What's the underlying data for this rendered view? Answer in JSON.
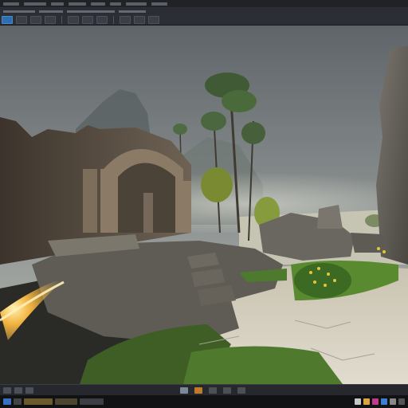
{
  "colors": {
    "sky_top": "#5e6468",
    "sky_bottom": "#a9adaa",
    "sand": "#cfc9bb",
    "grass": "#4f7a2e",
    "stone": "#6a6761",
    "accent_toolbar": "#2f6fb0",
    "fire": "#f2b542"
  },
  "icons": {
    "menubar": "menu-items",
    "toolbar": [
      "select-icon",
      "move-icon",
      "rotate-icon",
      "scale-icon",
      "play-icon",
      "settings-icon",
      "camera-icon",
      "snap-icon",
      "grid-icon",
      "lighting-icon"
    ],
    "statusbar": [
      "content-browser-icon",
      "output-log-icon",
      "cmd-icon",
      "source-control-icon"
    ],
    "taskbar": [
      "start-icon",
      "search-icon",
      "editor-app-icon",
      "folder-icon",
      "browser-icon"
    ]
  },
  "viewport": {
    "scene": "ruins-landscape"
  }
}
